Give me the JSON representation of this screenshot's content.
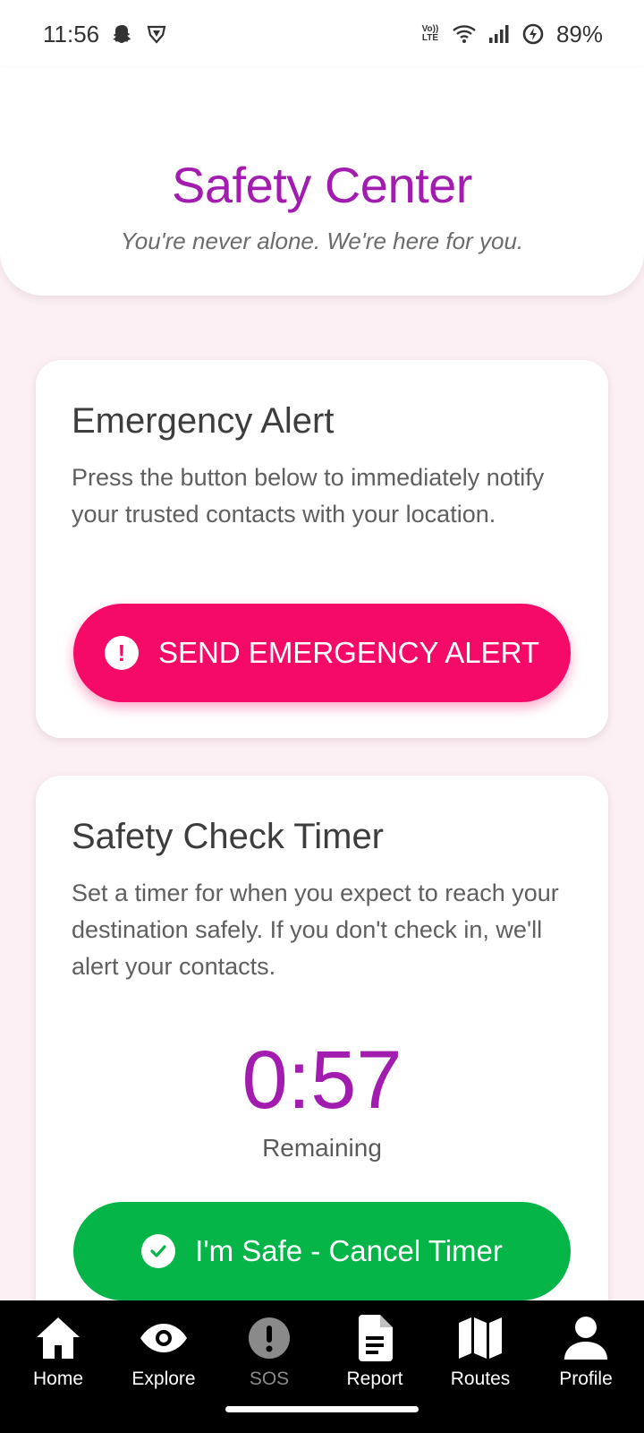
{
  "status_bar": {
    "time": "11:56",
    "battery": "89%",
    "network_label": "Vo)) LTE",
    "icons": [
      "snapchat-icon",
      "vpn-shield-icon",
      "volte-icon",
      "wifi-icon",
      "signal-icon",
      "battery-saver-icon"
    ]
  },
  "header": {
    "title": "Safety Center",
    "subtitle": "You're never alone. We're here for you."
  },
  "emergency_card": {
    "title": "Emergency Alert",
    "description": "Press the button below to immediately notify your trusted contacts with your location.",
    "button_label": "SEND EMERGENCY ALERT",
    "button_icon": "exclamation-circle-icon"
  },
  "timer_card": {
    "title": "Safety Check Timer",
    "description": "Set a timer for when you expect to reach your destination safely. If you don't check in, we'll alert your contacts.",
    "timer_value": "0:57",
    "timer_label": "Remaining",
    "button_label": "I'm Safe - Cancel Timer",
    "button_icon": "check-circle-icon"
  },
  "bottom_nav": {
    "items": [
      {
        "label": "Home",
        "icon": "home-icon"
      },
      {
        "label": "Explore",
        "icon": "eye-icon"
      },
      {
        "label": "SOS",
        "icon": "exclamation-circle-icon"
      },
      {
        "label": "Report",
        "icon": "document-icon"
      },
      {
        "label": "Routes",
        "icon": "map-icon"
      },
      {
        "label": "Profile",
        "icon": "user-icon"
      }
    ]
  },
  "colors": {
    "accent": "#a21caf",
    "alert": "#f50a67",
    "safe": "#06b548",
    "background": "#fdf0f4"
  }
}
